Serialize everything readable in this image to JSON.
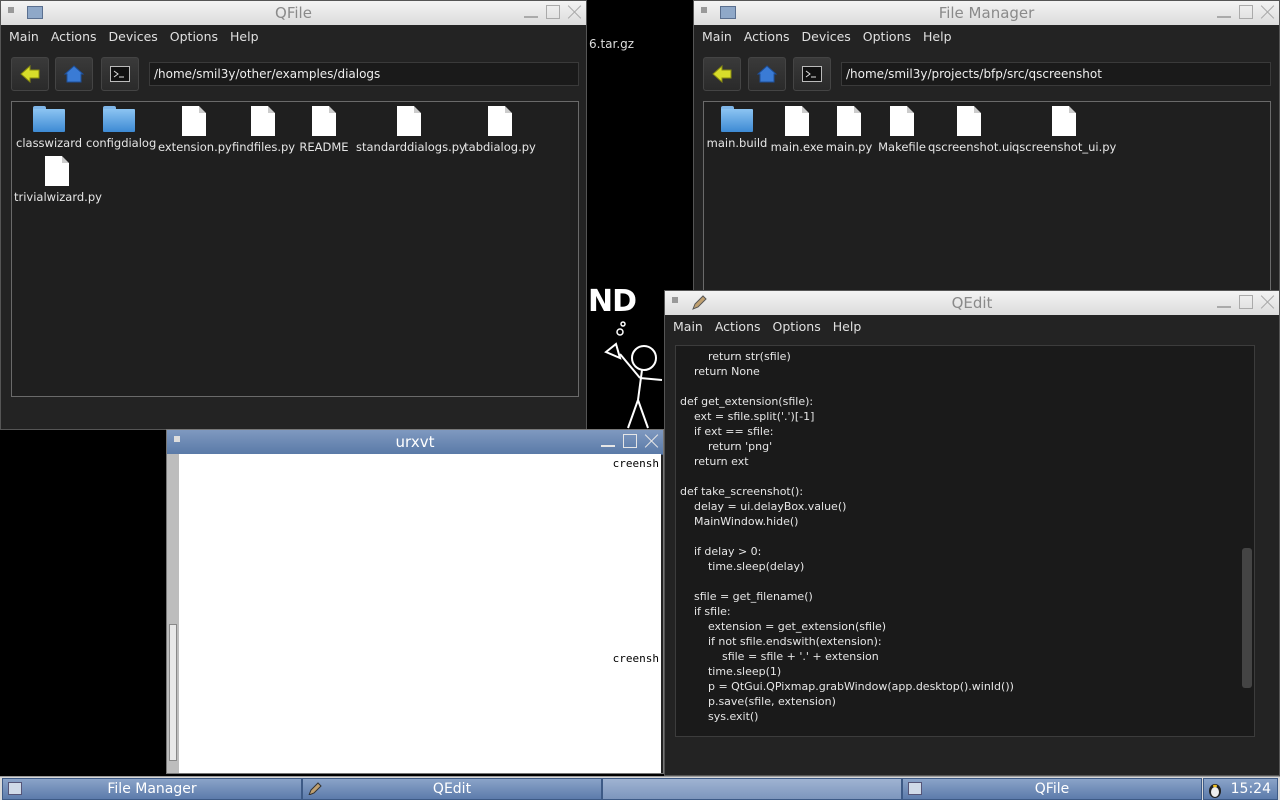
{
  "desktop": {
    "partial_filename": "6.tar.gz",
    "logo_fragment": "ND"
  },
  "qfile": {
    "title": "QFile",
    "menu": [
      "Main",
      "Actions",
      "Devices",
      "Options",
      "Help"
    ],
    "path": "/home/smil3y/other/examples/dialogs",
    "files": [
      {
        "name": "classwizard",
        "icon": "folder-icon"
      },
      {
        "name": "configdialog",
        "icon": "folder-icon"
      },
      {
        "name": "extension.py",
        "icon": "file-icon"
      },
      {
        "name": "findfiles.py",
        "icon": "file-icon"
      },
      {
        "name": "README",
        "icon": "file-icon"
      },
      {
        "name": "standarddialogs.py",
        "icon": "file-icon"
      },
      {
        "name": "tabdialog.py",
        "icon": "file-icon"
      },
      {
        "name": "trivialwizard.py",
        "icon": "file-icon"
      }
    ]
  },
  "filemanager": {
    "title": "File Manager",
    "menu": [
      "Main",
      "Actions",
      "Devices",
      "Options",
      "Help"
    ],
    "path": "/home/smil3y/projects/bfp/src/qscreenshot",
    "files": [
      {
        "name": "main.build",
        "icon": "folder-icon"
      },
      {
        "name": "main.exe",
        "icon": "file-icon"
      },
      {
        "name": "main.py",
        "icon": "file-icon"
      },
      {
        "name": "Makefile",
        "icon": "file-icon"
      },
      {
        "name": "qscreenshot.ui",
        "icon": "file-icon"
      },
      {
        "name": "qscreenshot_ui.py",
        "icon": "file-icon"
      }
    ]
  },
  "qedit": {
    "title": "QEdit",
    "menu": [
      "Main",
      "Actions",
      "Options",
      "Help"
    ],
    "code": "        return str(sfile)\n    return None\n\ndef get_extension(sfile):\n    ext = sfile.split('.')[-1]\n    if ext == sfile:\n        return 'png'\n    return ext\n\ndef take_screenshot():\n    delay = ui.delayBox.value()\n    MainWindow.hide()\n\n    if delay > 0:\n        time.sleep(delay)\n\n    sfile = get_filename()\n    if sfile:\n        extension = get_extension(sfile)\n        if not sfile.endswith(extension):\n            sfile = sfile + '.' + extension\n        time.sleep(1)\n        p = QtGui.QPixmap.grabWindow(app.desktop().winId())\n        p.save(sfile, extension)\n        sys.exit()"
  },
  "urxvt": {
    "title": "urxvt",
    "line1": "creensh",
    "line2": "creensh"
  },
  "taskbar": {
    "tasks": [
      "File Manager",
      "QEdit",
      "",
      "QFile"
    ],
    "clock": "15:24"
  },
  "colors": {
    "titlebar_active": "#6b88b5",
    "window_bg": "#232323",
    "folder": "#5aa0e0",
    "back_arrow": "#d8dd2a",
    "home": "#3a7bd5"
  }
}
